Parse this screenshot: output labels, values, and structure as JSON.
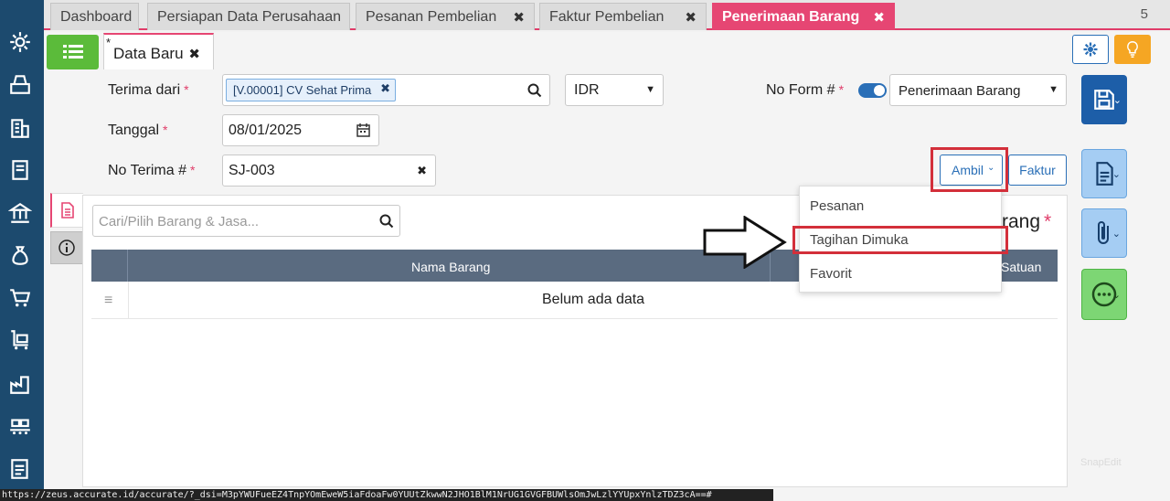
{
  "tabs": [
    {
      "label": "Dashboard",
      "closable": false,
      "active": false
    },
    {
      "label": "Persiapan Data Perusahaan",
      "closable": false,
      "active": false
    },
    {
      "label": "Pesanan Pembelian",
      "closable": true,
      "active": false
    },
    {
      "label": "Faktur Pembelian",
      "closable": true,
      "active": false
    },
    {
      "label": "Penerimaan Barang",
      "closable": true,
      "active": true
    }
  ],
  "tab_count": "5",
  "subtab": {
    "marker": "*",
    "label": "Data Baru"
  },
  "form": {
    "terima_dari_label": "Terima dari",
    "vendor_tag": "[V.00001] CV Sehat Prima",
    "currency": "IDR",
    "tanggal_label": "Tanggal",
    "tanggal_value": "08/01/2025",
    "no_terima_label": "No Terima #",
    "no_terima_value": "SJ-003",
    "no_form_label": "No Form #",
    "form_type": "Penerimaan Barang"
  },
  "buttons": {
    "ambil": "Ambil",
    "faktur": "Faktur"
  },
  "search": {
    "placeholder": "Cari/Pilih Barang & Jasa..."
  },
  "section_title_fragment": "rang",
  "table": {
    "columns": [
      "Nama Barang",
      "Satuan"
    ],
    "empty_text": "Belum ada data",
    "row_handle": "≡"
  },
  "dropdown": {
    "items": [
      "Pesanan",
      "Tagihan Dimuka",
      "Favorit"
    ],
    "highlighted": "Tagihan Dimuka"
  },
  "status_url": "https://zeus.accurate.id/accurate/?_dsi=M3pYWUFueEZ4TnpYOmEweW5iaFdoaFw0YUUtZkwwN2JHO1BlM1NrUG1GVGFBUWlsOmJwLzlYYUpxYnlzTDZ3cA==#",
  "watermark": "SnapEdit",
  "colors": {
    "accent": "#e64673",
    "sidebar": "#1c4a6e",
    "primary": "#2a6fb7",
    "highlight": "#d32f3a"
  }
}
